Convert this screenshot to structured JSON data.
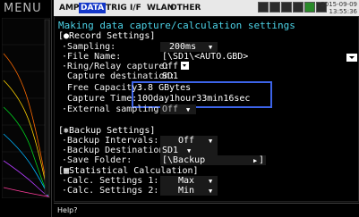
{
  "left": {
    "menu_label": "MENU"
  },
  "tabs": [
    {
      "label": "AMP"
    },
    {
      "label": "DATA"
    },
    {
      "label": "TRIG"
    },
    {
      "label": "I/F"
    },
    {
      "label": "WLAN"
    },
    {
      "label": "OTHER"
    }
  ],
  "header": {
    "date": "2015-09-09",
    "time": "13:55:36"
  },
  "page_title": "Making data capture/calculation settings",
  "record": {
    "heading": "[●Record Settings]",
    "sampling_label": "·Sampling:",
    "sampling_value": "200ms",
    "file_name_label": "·File Name:",
    "file_name_value": "[\\SD1\\<AUTO.GBD>",
    "ring_label": "·Ring/Relay capture:",
    "ring_value": "Off",
    "destination_label": "Capture destination:",
    "destination_value": "SD1",
    "free_label": "Free Capacity:",
    "free_value": "3.8 GBytes",
    "time_label": "Capture Time:",
    "time_value": "10Oday1hour33min16sec",
    "external_label": "·External sampling:",
    "external_value": "Off"
  },
  "backup": {
    "heading": "[❅Backup Settings]",
    "intervals_label": "·Backup Intervals:",
    "intervals_value": "Off",
    "destination_label": "·Backup Destination:",
    "destination_value": "SD1",
    "folder_label": "·Save Folder:",
    "folder_value": "[\\Backup"
  },
  "stats": {
    "heading": "[▦Statistical Calculation]",
    "calc1_label": "·Calc. Settings 1:",
    "calc1_value": "Max",
    "calc2_label": "·Calc. Settings 2:",
    "calc2_value": "Min"
  },
  "help": {
    "text": "Help?"
  },
  "colors": {
    "accent": "#1437c8",
    "title": "#4cd2e6",
    "highlight": "#3c63e8"
  }
}
